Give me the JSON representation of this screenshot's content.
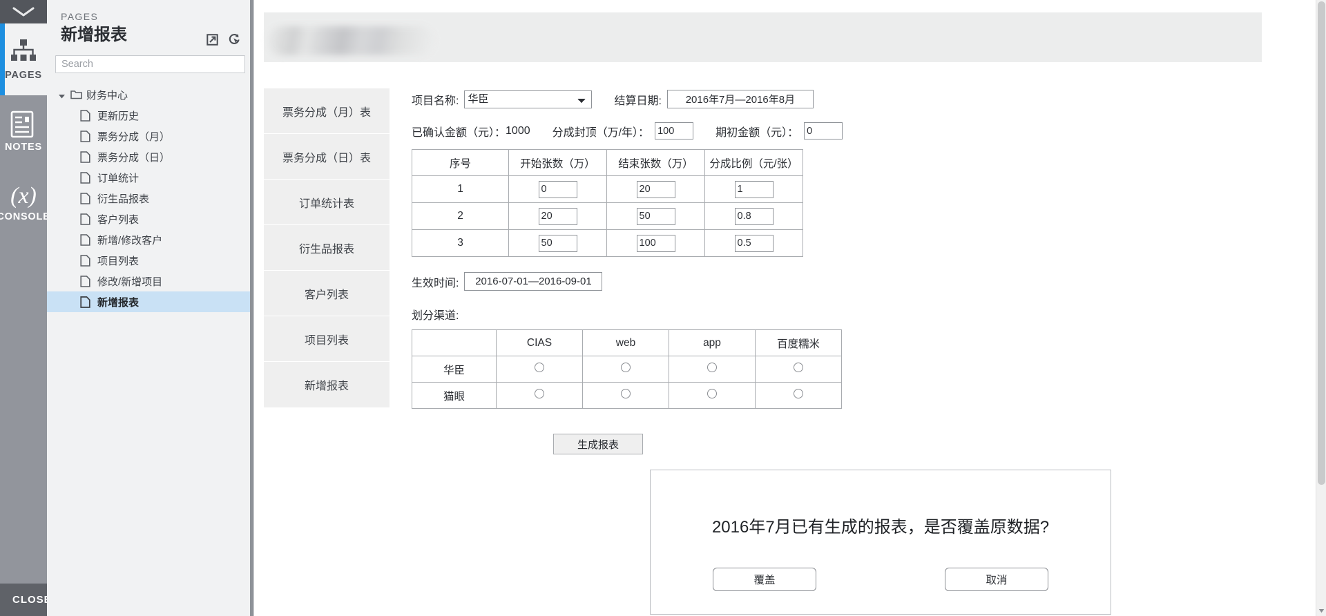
{
  "rail": {
    "collapse_icon": "chevron-down-icon",
    "items": [
      {
        "label": "PAGES",
        "icon": "sitemap-icon",
        "active": true
      },
      {
        "label": "NOTES",
        "icon": "note-page-icon",
        "active": false
      },
      {
        "label": "CONSOLE",
        "icon": "math-variable-icon",
        "active": false
      }
    ],
    "close_label": "CLOSE"
  },
  "sidebar": {
    "kicker": "PAGES",
    "title": "新增报表",
    "actions": [
      {
        "name": "open-external-icon"
      },
      {
        "name": "preview-cursor-icon"
      }
    ],
    "search": {
      "placeholder": "Search",
      "value": ""
    },
    "tree": {
      "group": {
        "label": "财务中心",
        "icon": "folder-icon",
        "expanded": true
      },
      "items": [
        {
          "label": "更新历史",
          "selected": false
        },
        {
          "label": "票务分成（月）",
          "selected": false
        },
        {
          "label": "票务分成（日）",
          "selected": false
        },
        {
          "label": "订单统计",
          "selected": false
        },
        {
          "label": "衍生品报表",
          "selected": false
        },
        {
          "label": "客户列表",
          "selected": false
        },
        {
          "label": "新增/修改客户",
          "selected": false
        },
        {
          "label": "项目列表",
          "selected": false
        },
        {
          "label": "修改/新增项目",
          "selected": false
        },
        {
          "label": "新增报表",
          "selected": true
        }
      ]
    }
  },
  "main": {
    "tabs": [
      {
        "label": "票务分成（月）表"
      },
      {
        "label": "票务分成（日）表"
      },
      {
        "label": "订单统计表"
      },
      {
        "label": "衍生品报表"
      },
      {
        "label": "客户列表"
      },
      {
        "label": "项目列表"
      },
      {
        "label": "新增报表"
      }
    ],
    "form": {
      "project_label": "项目名称:",
      "project_value": "华臣",
      "project_options": [
        "华臣"
      ],
      "settle_label": "结算日期:",
      "settle_value": "2016年7月—2016年8月",
      "confirmed_label": "已确认金额（元）：",
      "confirmed_value": "1000",
      "cap_label": "分成封顶（万/年）：",
      "cap_value": "100",
      "initial_label": "期初金额（元）：",
      "initial_value": "0",
      "effective_label": "生效时间:",
      "effective_value": "2016-07-01—2016-09-01",
      "channel_label": "划分渠道:"
    },
    "rate_table": {
      "headers": [
        "序号",
        "开始张数（万）",
        "结束张数（万）",
        "分成比例（元/张）"
      ],
      "rows": [
        {
          "index": "1",
          "start": "0",
          "end": "20",
          "ratio": "1"
        },
        {
          "index": "2",
          "start": "20",
          "end": "50",
          "ratio": "0.8"
        },
        {
          "index": "3",
          "start": "50",
          "end": "100",
          "ratio": "0.5"
        }
      ]
    },
    "channel_table": {
      "headers": [
        "",
        "CIAS",
        "web",
        "app",
        "百度糯米"
      ],
      "rows": [
        {
          "name": "华臣",
          "cells": [
            "radio",
            "radio",
            "radio",
            "radio"
          ]
        },
        {
          "name": "猫眼",
          "cells": [
            "radio",
            "radio",
            "radio",
            "radio"
          ]
        }
      ]
    },
    "generate_button": "生成报表",
    "dialog": {
      "message": "2016年7月已有生成的报表，是否覆盖原数据?",
      "confirm_label": "覆盖",
      "cancel_label": "取消"
    }
  },
  "colors": {
    "accent": "#1e8fe0",
    "rail_bg": "#92959c",
    "sidebar_bg": "#f1f2f3",
    "selected_row": "#c9e1f5",
    "tab_bg": "#efefef"
  }
}
